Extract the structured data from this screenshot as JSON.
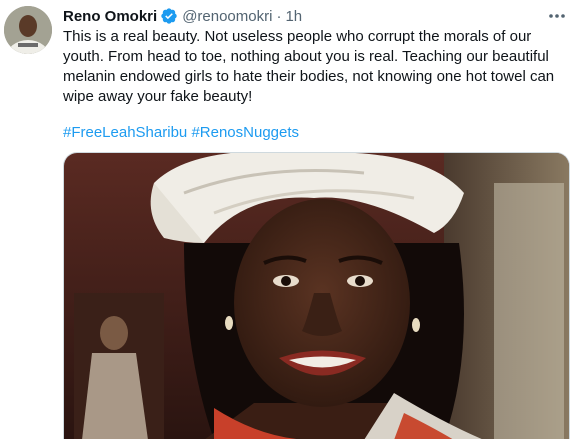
{
  "tweet": {
    "author_name": "Reno Omokri",
    "handle": "@renoomokri",
    "separator": "·",
    "time": "1h",
    "body": "This is a real beauty. Not useless people who corrupt the morals of our youth. From head to toe, nothing about you is real. Teaching our beautiful melanin endowed girls to hate their bodies, not knowing one hot towel can wipe away your fake beauty!",
    "hashtags": [
      "#FreeLeahSharibu",
      "#RenosNuggets"
    ]
  },
  "colors": {
    "link": "#1d9bf0",
    "verified": "#1d9bf0",
    "secondary_text": "#536471"
  },
  "icons": {
    "verified": "verified-badge-icon",
    "more": "more-options-icon"
  }
}
